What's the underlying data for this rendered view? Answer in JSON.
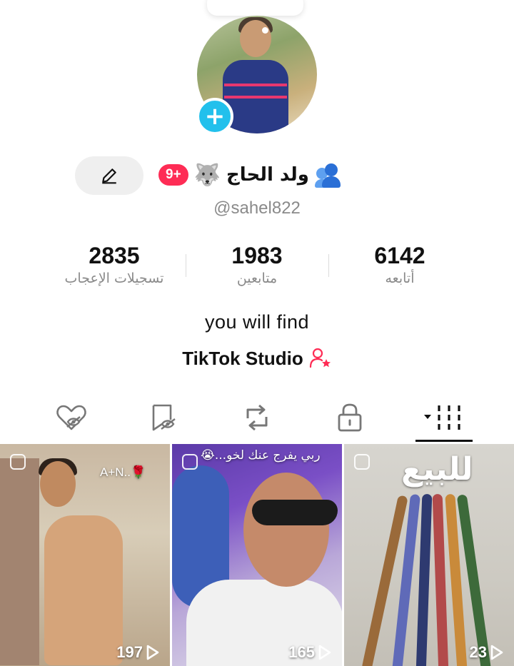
{
  "profile": {
    "display_name": "ولد الحاج",
    "wolf_emoji": "🐺",
    "badge": "9+",
    "username": "@sahel822",
    "bio": "you will find",
    "studio_label": "TikTok Studio",
    "add_symbol": "+"
  },
  "stats": {
    "following": {
      "value": "6142",
      "label": "أتابعه"
    },
    "followers": {
      "value": "1983",
      "label": "متابعين"
    },
    "likes": {
      "value": "2835",
      "label": "تسجيلات الإعجاب"
    }
  },
  "tabs": [
    "videos",
    "private",
    "reposts",
    "favorites",
    "liked"
  ],
  "videos": [
    {
      "caption": "A+N..🌹",
      "views": "197"
    },
    {
      "caption": "ربي يفرج عنك لخو...😭",
      "views": "165"
    },
    {
      "caption": "للبيع",
      "views": "23"
    }
  ],
  "colors": {
    "accent": "#fe2c55",
    "add_button": "#22c0ec"
  }
}
